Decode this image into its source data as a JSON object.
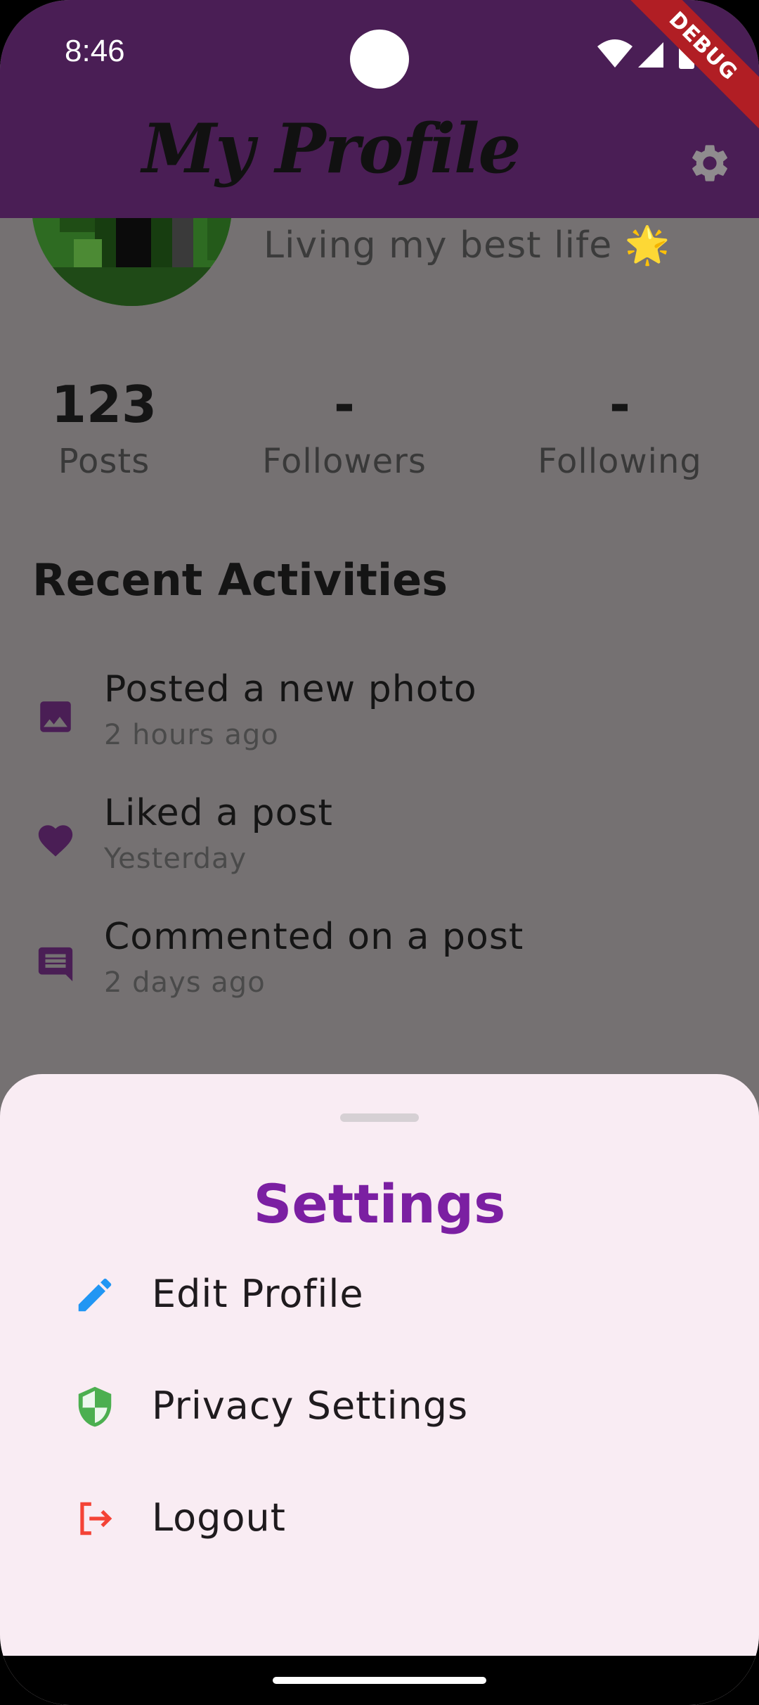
{
  "status_bar": {
    "time": "8:46"
  },
  "app_bar": {
    "title": "My Profile",
    "debug_label": "DEBUG"
  },
  "profile": {
    "bio": "Living my best life 🌟",
    "stats": [
      {
        "value": "123",
        "label": "Posts"
      },
      {
        "value": "-",
        "label": "Followers"
      },
      {
        "value": "-",
        "label": "Following"
      }
    ]
  },
  "recent": {
    "title": "Recent Activities",
    "items": [
      {
        "icon": "image-icon",
        "title": "Posted a new photo",
        "time": "2 hours ago"
      },
      {
        "icon": "heart-icon",
        "title": "Liked a post",
        "time": "Yesterday"
      },
      {
        "icon": "comment-icon",
        "title": "Commented on a post",
        "time": "2 days ago"
      }
    ]
  },
  "settings_sheet": {
    "title": "Settings",
    "items": [
      {
        "icon": "edit-icon",
        "label": "Edit Profile",
        "color": "#2196f3"
      },
      {
        "icon": "shield-icon",
        "label": "Privacy Settings",
        "color": "#4caf50"
      },
      {
        "icon": "logout-icon",
        "label": "Logout",
        "color": "#f44336"
      }
    ]
  },
  "colors": {
    "app_bar": "#4a1e55",
    "accent": "#7b1fa2",
    "activity_icon": "#4a1e55",
    "sheet_bg": "#f9ecf3"
  }
}
